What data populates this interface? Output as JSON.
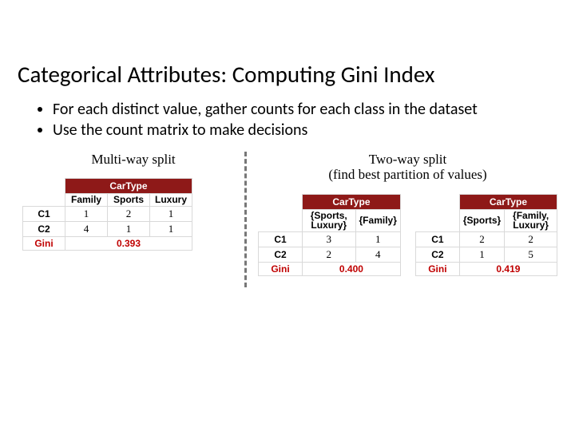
{
  "title": "Categorical Attributes: Computing Gini Index",
  "bullets": [
    "For each distinct value, gather counts for each class in the dataset",
    "Use the count matrix to make decisions"
  ],
  "captions": {
    "left": "Multi-way split",
    "right_line1": "Two-way split",
    "right_line2": "(find best partition of values)"
  },
  "common": {
    "header": "CarType",
    "class_rows": [
      "C1",
      "C2"
    ],
    "gini_label": "Gini"
  },
  "tables": {
    "multi": {
      "cols": [
        "Family",
        "Sports",
        "Luxury"
      ],
      "rows": [
        [
          1,
          2,
          1
        ],
        [
          4,
          1,
          1
        ]
      ],
      "gini": "0.393"
    },
    "twoA": {
      "cols": [
        "{Sports, Luxury}",
        "{Family}"
      ],
      "rows": [
        [
          3,
          1
        ],
        [
          2,
          4
        ]
      ],
      "gini": "0.400"
    },
    "twoB": {
      "cols": [
        "{Sports}",
        "{Family, Luxury}"
      ],
      "rows": [
        [
          2,
          2
        ],
        [
          1,
          5
        ]
      ],
      "gini": "0.419"
    }
  }
}
